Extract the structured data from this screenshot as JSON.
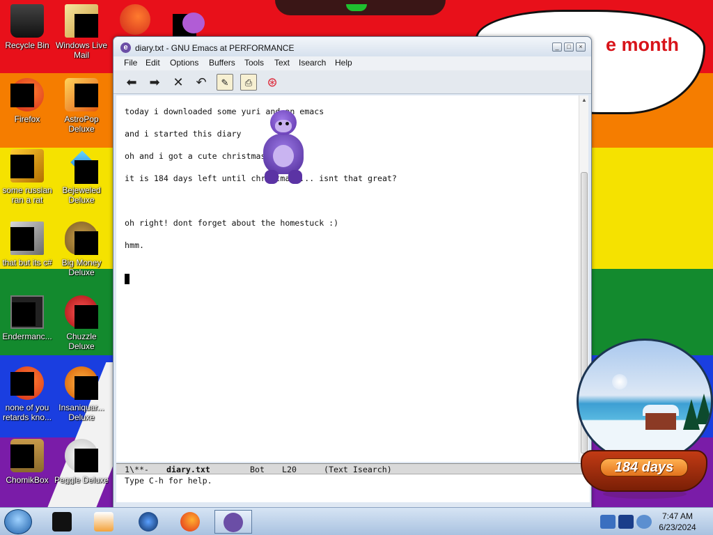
{
  "desktop": {
    "bubble_text": "e month",
    "icons": [
      {
        "label": "Recycle Bin"
      },
      {
        "label": "Windows Live Mail"
      },
      {
        "label": "Firefox"
      },
      {
        "label": "AstroPop Deluxe"
      },
      {
        "label": "some russian ran a rat"
      },
      {
        "label": "Bejeweled Deluxe"
      },
      {
        "label": "that but its c#"
      },
      {
        "label": "Big Money Deluxe"
      },
      {
        "label": "Endermanc..."
      },
      {
        "label": "Chuzzle Deluxe"
      },
      {
        "label": "none of you retards kno..."
      },
      {
        "label": "Insaniquar... Deluxe"
      },
      {
        "label": "ChomikBox"
      },
      {
        "label": "Peggle Deluxe"
      }
    ]
  },
  "window": {
    "title": "diary.txt - GNU Emacs at PERFORMANCE",
    "menu": [
      "File",
      "Edit",
      "Options",
      "Buffers",
      "Tools",
      "Text",
      "Isearch",
      "Help"
    ],
    "lines": [
      "today i downloaded some yuri and an emacs",
      "and i started this diary",
      "oh and i got a cute christmas globe!",
      "it is 184 days left until christmas.... isnt that great?",
      "",
      "oh right! dont forget about the homestuck :)",
      "hmm."
    ],
    "modeline": {
      "status": "1\\**-",
      "buffer": "diary.txt",
      "position": "Bot",
      "line": "L20",
      "mode": "(Text Isearch)"
    },
    "echo": "Type C-h for help."
  },
  "globe": {
    "days_label": "184 days"
  },
  "taskbar": {
    "time": "7:47 AM",
    "date": "6/23/2024"
  },
  "colors": {
    "bubble_text": "#d8141a",
    "accent_emacs": "#6b4ea6"
  }
}
